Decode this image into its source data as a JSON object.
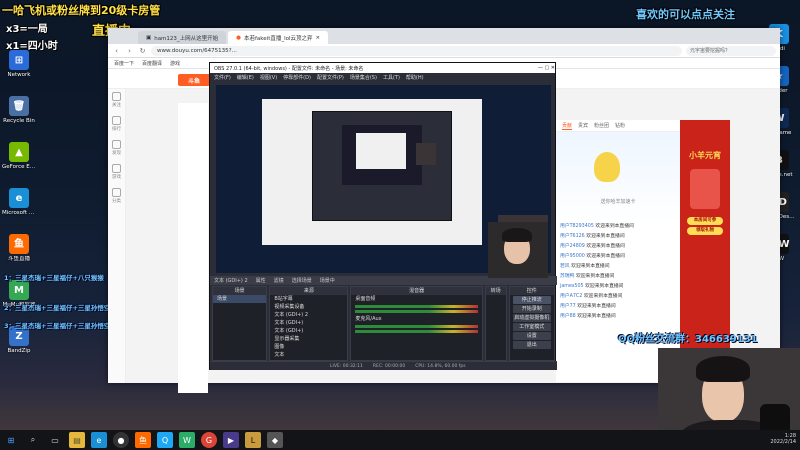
{
  "overlay": {
    "top_line": "一哈飞机或粉丝牌到20级卡房管",
    "rule1": "x3=一局",
    "rule2": "x1=四小时",
    "live": "直播中",
    "follow": "喜欢的可以点点关注",
    "qq_group": "QQ粉丝交流群：346639131",
    "left_note1": "一哈飞机或粉丝牌到20级卡房管",
    "left_note2": "1：三星杰瑞+三星福仔+八只猴猴",
    "left_note3": "2：三星杰瑞+三星福仔+三星孙悟空",
    "left_note4": "3：三星杰瑞+三星福仔+三星孙悟空+三星托德"
  },
  "desktop_left": [
    {
      "label": "Network",
      "icon": "network-icon",
      "color": "#2a6bd8",
      "glyph": "⊞"
    },
    {
      "label": "Recycle Bin",
      "icon": "recycle-bin-icon",
      "color": "#4a6fa5",
      "glyph": "🗑"
    },
    {
      "label": "GeForce Experience",
      "icon": "geforce-icon",
      "color": "#76b900",
      "glyph": "▲"
    },
    {
      "label": "Microsoft Edge",
      "icon": "edge-icon",
      "color": "#1a8fd6",
      "glyph": "e"
    },
    {
      "label": "斗鱼直播",
      "icon": "douyu-icon",
      "color": "#ff6a00",
      "glyph": "鱼"
    },
    {
      "label": "MuMu模拟器",
      "icon": "mumu-icon",
      "color": "#34a853",
      "glyph": "M"
    },
    {
      "label": "BandZip",
      "icon": "bandzip-icon",
      "color": "#3471c9",
      "glyph": "Z"
    }
  ],
  "desktop_right": [
    {
      "label": "Kodi",
      "icon": "kodi-icon",
      "color": "#1a8fe3",
      "glyph": "K"
    },
    {
      "label": "Folder",
      "icon": "star-icon",
      "color": "#1565c0",
      "glyph": "★"
    },
    {
      "label": "WeGame",
      "icon": "wegame-icon",
      "color": "#0f2a55",
      "glyph": "W"
    },
    {
      "label": "Battle.net",
      "icon": "battlenet-icon",
      "color": "#111",
      "glyph": "B"
    },
    {
      "label": "Black Desert",
      "icon": "game-icon",
      "color": "#222",
      "glyph": "BD"
    },
    {
      "label": "MW",
      "icon": "mw-icon",
      "color": "#111",
      "glyph": "MW"
    }
  ],
  "browser": {
    "tabs": [
      "ham123_上网从这里开始",
      "本若fakeit直播_lol云顶之弈"
    ],
    "url": "www.douyu.com/6475135?...",
    "search_placeholder": "元宇宙要挖掘吗？",
    "bookmarks": [
      "百度一下",
      "百度翻译",
      "游戏"
    ],
    "logo": "斗鱼",
    "sidebar": [
      "关注",
      "排行",
      "发现",
      "游戏",
      "分类"
    ]
  },
  "obs": {
    "title": "OBS 27.0.1 (64-bit, windows) - 配置文件: 未命名 - 场景: 未命名",
    "menu": [
      "文件(F)",
      "编辑(E)",
      "视图(V)",
      "停靠部件(D)",
      "配置文件(P)",
      "场景集合(S)",
      "工具(T)",
      "帮助(H)"
    ],
    "source_bar": [
      "文本 (GDI+) 2",
      "属性",
      "滤镜",
      "选择场景",
      "场景中"
    ],
    "docks": {
      "scenes": "场景",
      "sources": "来源",
      "mixer": "混音器",
      "transitions": "转场",
      "controls": "控件"
    },
    "scene_items": [
      "场景"
    ],
    "source_items": [
      "B站字幕",
      "视频采集设备",
      "文本 (GDI+) 2",
      "文本 (GDI+)",
      "文本 (GDI+)",
      "显示器采集",
      "图像",
      "文本"
    ],
    "mixer_items": [
      "桌面音频",
      "麦克风/Aux"
    ],
    "controls": [
      "停止推流",
      "开始录制",
      "启动虚拟摄像机",
      "工作室模式",
      "设置",
      "退出"
    ],
    "status": [
      "LIVE: 00:32:11",
      "REC: 00:00:00",
      "CPU: 14.8%, 60.00 fps"
    ]
  },
  "chat": {
    "tabs": [
      "贡献",
      "贵宾",
      "粉丝团",
      "钻粉"
    ],
    "lines": [
      {
        "user": "用户T8293405",
        "msg": "欢迎来到本直播间"
      },
      {
        "user": "用户T6126",
        "msg": "欢迎来到本直播间"
      },
      {
        "user": "用户24809",
        "msg": "欢迎来到本直播间"
      },
      {
        "user": "用户95000",
        "msg": "欢迎来到本直播间"
      },
      {
        "user": "若风",
        "msg": "欢迎来到本直播间"
      },
      {
        "user": "苏瑞鸭",
        "msg": "欢迎来到本直播间"
      },
      {
        "user": "james505",
        "msg": "欢迎来到本直播间"
      },
      {
        "user": "用户A7C2",
        "msg": "欢迎来到本直播间"
      },
      {
        "user": "用户77",
        "msg": "欢迎来到本直播间"
      },
      {
        "user": "用户88",
        "msg": "欢迎来到本直播间"
      }
    ],
    "welcome_card": "送你哈羊加速卡"
  },
  "promo": {
    "title": "小羊元宵",
    "btn1": "本房间可参",
    "btn2": "领取礼物"
  },
  "taskbar": {
    "time": "1:28",
    "date": "2022/2/14"
  }
}
